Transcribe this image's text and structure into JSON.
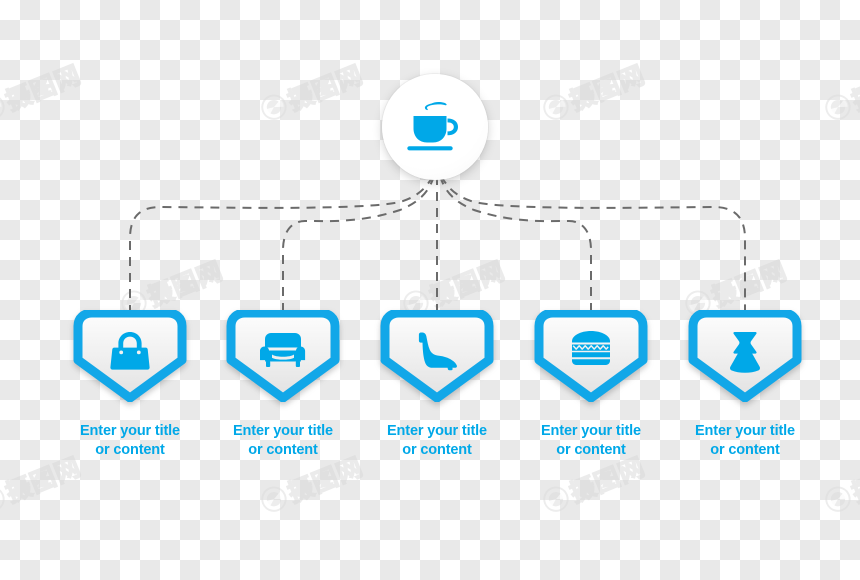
{
  "theme": {
    "accent": "#00a8e8",
    "accent_dark": "#0a9ee0",
    "line_color": "#6b6b6b",
    "shield_fill_top": "#fdfdfd",
    "shield_fill_bottom": "#e2e2e2",
    "circle_fill": "#ffffff",
    "checker_light": "#ffffff",
    "checker_dark": "#e9e9e9",
    "watermark_color": "#d8d8d8"
  },
  "diagram": {
    "type": "hierarchy-tree",
    "title": "",
    "root": {
      "icon": "coffee-cup-icon",
      "label": ""
    },
    "branch_count": 5,
    "nodes": [
      {
        "icon": "handbag-icon",
        "title_line1": "Enter your title",
        "title_line2": "or content"
      },
      {
        "icon": "armchair-icon",
        "title_line1": "Enter your title",
        "title_line2": "or content"
      },
      {
        "icon": "high-heel-shoe-icon",
        "title_line1": "Enter your title",
        "title_line2": "or content"
      },
      {
        "icon": "hamburger-icon",
        "title_line1": "Enter your title",
        "title_line2": "or content"
      },
      {
        "icon": "dress-icon",
        "title_line1": "Enter your title",
        "title_line2": "or content"
      }
    ]
  },
  "watermark": {
    "text": "摄图网",
    "logo": "camera-aperture-icon"
  }
}
